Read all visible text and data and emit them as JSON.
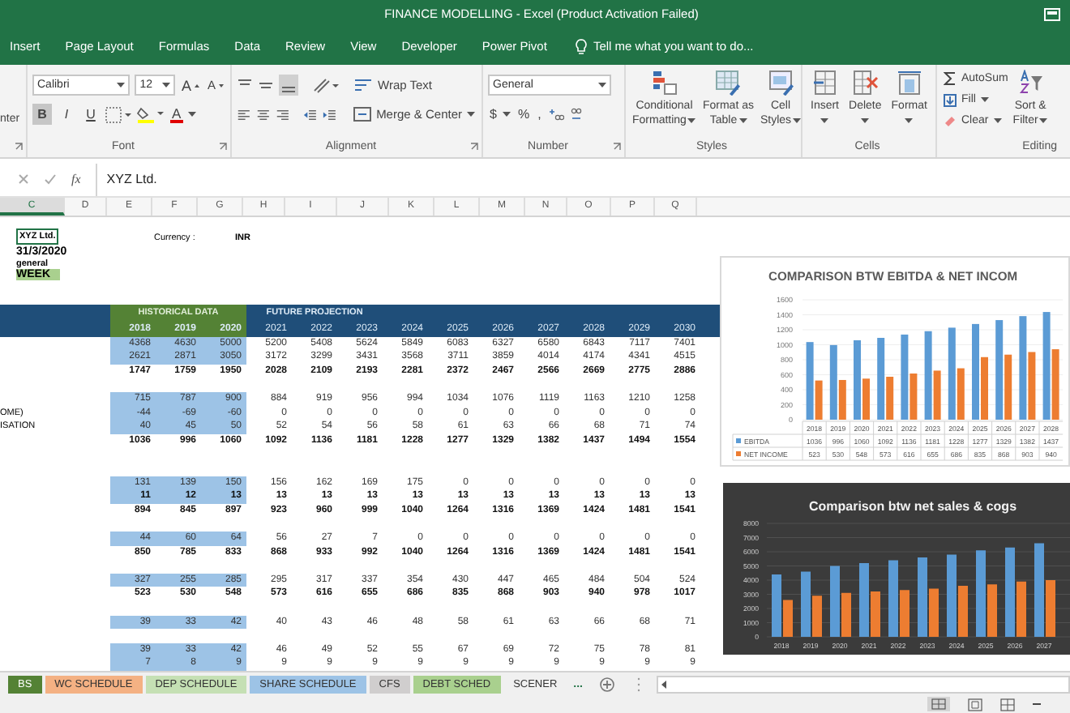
{
  "window": {
    "title": "FINANCE MODELLING - Excel (Product Activation Failed)"
  },
  "ribbon_tabs": [
    "Insert",
    "Page Layout",
    "Formulas",
    "Data",
    "Review",
    "View",
    "Developer",
    "Power Pivot"
  ],
  "tell_me": {
    "placeholder": "Tell me what you want to do..."
  },
  "ribbon": {
    "clipboard_partial": "nter",
    "font": {
      "name": "Calibri",
      "size": "12",
      "grow": "A",
      "shrink": "A",
      "font_color": "A",
      "label": "Font",
      "styles": [
        {
          "label": "B",
          "on": true
        },
        {
          "label": "I",
          "on": false
        },
        {
          "label": "U",
          "on": false
        }
      ]
    },
    "alignment": {
      "wrap": "Wrap Text",
      "merge": "Merge & Center",
      "label": "Alignment"
    },
    "number": {
      "format": "General",
      "currency": "$",
      "percent": "%",
      "comma": ",",
      "label": "Number"
    },
    "styles": {
      "label": "Styles",
      "buttons": [
        {
          "kind": "conditional",
          "lines": [
            "Conditional",
            "Formatting"
          ]
        },
        {
          "kind": "table",
          "lines": [
            "Format as",
            "Table"
          ]
        },
        {
          "kind": "cellstyles",
          "lines": [
            "Cell",
            "Styles"
          ]
        }
      ]
    },
    "cells": {
      "label": "Cells",
      "buttons": [
        {
          "kind": "insert",
          "label": "Insert"
        },
        {
          "kind": "delete",
          "label": "Delete"
        },
        {
          "kind": "format",
          "label": "Format"
        }
      ]
    },
    "editing": {
      "label": "Editing",
      "autosum": "AutoSum",
      "fill": "Fill",
      "clear": "Clear",
      "sort_lines": [
        "Sort &",
        "Filter"
      ]
    }
  },
  "formula_bar": {
    "function_label": "fx",
    "value": "XYZ Ltd."
  },
  "column_headers": [
    {
      "label": "C",
      "selected": true
    },
    {
      "label": "D",
      "selected": false
    },
    {
      "label": "E",
      "selected": false
    },
    {
      "label": "F",
      "selected": false
    },
    {
      "label": "G",
      "selected": false
    },
    {
      "label": "H",
      "selected": false
    },
    {
      "label": "I",
      "selected": false
    },
    {
      "label": "J",
      "selected": false
    },
    {
      "label": "K",
      "selected": false
    },
    {
      "label": "L",
      "selected": false
    },
    {
      "label": "M",
      "selected": false
    },
    {
      "label": "N",
      "selected": false
    },
    {
      "label": "O",
      "selected": false
    },
    {
      "label": "P",
      "selected": false
    },
    {
      "label": "Q",
      "selected": false
    }
  ],
  "sheet": {
    "company": "XYZ Ltd.",
    "date": "31/3/2020",
    "type": "general",
    "period": "WEEK",
    "currency_label": "Currency :",
    "currency": "INR"
  },
  "projection_table": {
    "historical_label": "HISTORICAL DATA",
    "projection_label": "FUTURE PROJECTION",
    "historical_years": [
      "2018",
      "2019",
      "2020"
    ],
    "projection_years": [
      "2021",
      "2022",
      "2023",
      "2024",
      "2025",
      "2026",
      "2027",
      "2028",
      "2029",
      "2030"
    ],
    "rows": [
      {
        "kind": "values",
        "shaded": true,
        "bold": false,
        "values": [
          "4368",
          "4630",
          "5000",
          "5200",
          "5408",
          "5624",
          "5849",
          "6083",
          "6327",
          "6580",
          "6843",
          "7117",
          "7401"
        ]
      },
      {
        "kind": "values",
        "shaded": true,
        "bold": false,
        "values": [
          "2621",
          "2871",
          "3050",
          "3172",
          "3299",
          "3431",
          "3568",
          "3711",
          "3859",
          "4014",
          "4174",
          "4341",
          "4515"
        ]
      },
      {
        "kind": "values",
        "shaded": false,
        "bold": true,
        "values": [
          "1747",
          "1759",
          "1950",
          "2028",
          "2109",
          "2193",
          "2281",
          "2372",
          "2467",
          "2566",
          "2669",
          "2775",
          "2886"
        ]
      },
      {
        "kind": "empty"
      },
      {
        "kind": "values",
        "shaded": true,
        "bold": false,
        "values": [
          "715",
          "787",
          "900",
          "884",
          "919",
          "956",
          "994",
          "1034",
          "1076",
          "1119",
          "1163",
          "1210",
          "1258"
        ]
      },
      {
        "kind": "values",
        "label": "OME)",
        "shaded": true,
        "bold": false,
        "values": [
          "-44",
          "-69",
          "-60",
          "0",
          "0",
          "0",
          "0",
          "0",
          "0",
          "0",
          "0",
          "0",
          "0"
        ]
      },
      {
        "kind": "values",
        "label": "ISATION",
        "shaded": true,
        "bold": false,
        "values": [
          "40",
          "45",
          "50",
          "52",
          "54",
          "56",
          "58",
          "61",
          "63",
          "66",
          "68",
          "71",
          "74"
        ]
      },
      {
        "kind": "values",
        "shaded": false,
        "bold": true,
        "values": [
          "1036",
          "996",
          "1060",
          "1092",
          "1136",
          "1181",
          "1228",
          "1277",
          "1329",
          "1382",
          "1437",
          "1494",
          "1554"
        ]
      },
      {
        "kind": "empty"
      },
      {
        "kind": "empty"
      },
      {
        "kind": "values",
        "shaded": true,
        "bold": false,
        "values": [
          "131",
          "139",
          "150",
          "156",
          "162",
          "169",
          "175",
          "0",
          "0",
          "0",
          "0",
          "0",
          "0"
        ]
      },
      {
        "kind": "values",
        "shaded": true,
        "bold": true,
        "values": [
          "11",
          "12",
          "13",
          "13",
          "13",
          "13",
          "13",
          "13",
          "13",
          "13",
          "13",
          "13",
          "13"
        ]
      },
      {
        "kind": "values",
        "shaded": false,
        "bold": true,
        "values": [
          "894",
          "845",
          "897",
          "923",
          "960",
          "999",
          "1040",
          "1264",
          "1316",
          "1369",
          "1424",
          "1481",
          "1541"
        ]
      },
      {
        "kind": "empty"
      },
      {
        "kind": "values",
        "shaded": true,
        "bold": false,
        "values": [
          "44",
          "60",
          "64",
          "56",
          "27",
          "7",
          "0",
          "0",
          "0",
          "0",
          "0",
          "0",
          "0"
        ]
      },
      {
        "kind": "values",
        "shaded": false,
        "bold": true,
        "values": [
          "850",
          "785",
          "833",
          "868",
          "933",
          "992",
          "1040",
          "1264",
          "1316",
          "1369",
          "1424",
          "1481",
          "1541"
        ]
      },
      {
        "kind": "empty"
      },
      {
        "kind": "values",
        "shaded": true,
        "bold": false,
        "values": [
          "327",
          "255",
          "285",
          "295",
          "317",
          "337",
          "354",
          "430",
          "447",
          "465",
          "484",
          "504",
          "524"
        ]
      },
      {
        "kind": "values",
        "shaded": false,
        "bold": true,
        "values": [
          "523",
          "530",
          "548",
          "573",
          "616",
          "655",
          "686",
          "835",
          "868",
          "903",
          "940",
          "978",
          "1017"
        ]
      },
      {
        "kind": "empty"
      },
      {
        "kind": "values",
        "shaded": true,
        "bold": false,
        "values": [
          "39",
          "33",
          "42",
          "40",
          "43",
          "46",
          "48",
          "58",
          "61",
          "63",
          "66",
          "68",
          "71"
        ]
      },
      {
        "kind": "empty"
      },
      {
        "kind": "values",
        "shaded": true,
        "bold": false,
        "values": [
          "39",
          "33",
          "42",
          "46",
          "49",
          "52",
          "55",
          "67",
          "69",
          "72",
          "75",
          "78",
          "81"
        ]
      },
      {
        "kind": "values",
        "shaded": true,
        "bold": false,
        "values": [
          "7",
          "8",
          "9",
          "9",
          "9",
          "9",
          "9",
          "9",
          "9",
          "9",
          "9",
          "9",
          "9"
        ]
      }
    ]
  },
  "charts": [
    {
      "chart_data": {
        "type": "bar",
        "title": "COMPARISON BTW EBITDA & NET INCOM",
        "categories": [
          "2018",
          "2019",
          "2020",
          "2021",
          "2022",
          "2023",
          "2024",
          "2025",
          "2026",
          "2027",
          "2028"
        ],
        "series": [
          {
            "name": "EBITDA",
            "color": "#5b9bd5",
            "values": [
              1036,
              996,
              1060,
              1092,
              1136,
              1181,
              1228,
              1277,
              1329,
              1382,
              1437
            ]
          },
          {
            "name": "NET INCOME",
            "color": "#ed7d31",
            "values": [
              523,
              530,
              548,
              573,
              616,
              655,
              686,
              835,
              868,
              903,
              940
            ]
          }
        ],
        "ylim": [
          0,
          1600
        ],
        "yticks": [
          {
            "value": 0,
            "label": "0"
          },
          {
            "value": 200,
            "label": "200"
          },
          {
            "value": 400,
            "label": "400"
          },
          {
            "value": 600,
            "label": "600"
          },
          {
            "value": 800,
            "label": "800"
          },
          {
            "value": 1000,
            "label": "1000"
          },
          {
            "value": 1200,
            "label": "1200"
          },
          {
            "value": 1400,
            "label": "1400"
          },
          {
            "value": 1600,
            "label": "1600"
          }
        ],
        "grid": true,
        "legend": true
      },
      "data_table": [
        {
          "values": [
            "1036",
            "996",
            "1060",
            "1092",
            "1136",
            "1181",
            "1228",
            "1277",
            "1329",
            "1382",
            "1437"
          ]
        },
        {
          "values": [
            "523",
            "530",
            "548",
            "573",
            "616",
            "655",
            "686",
            "835",
            "868",
            "903",
            "940"
          ]
        }
      ]
    },
    {
      "chart_data": {
        "type": "bar",
        "title": "Comparison btw net sales & cogs",
        "categories": [
          "2018",
          "2019",
          "2020",
          "2021",
          "2022",
          "2023",
          "2024",
          "2025",
          "2026",
          "2027"
        ],
        "series": [
          {
            "color": "#5b9bd5",
            "values": [
              4400,
              4600,
              5000,
              5200,
              5400,
              5600,
              5800,
              6100,
              6300,
              6600
            ]
          },
          {
            "color": "#ed7d31",
            "values": [
              2600,
              2900,
              3100,
              3200,
              3300,
              3400,
              3600,
              3700,
              3900,
              4000
            ]
          }
        ],
        "ylim": [
          0,
          8000
        ],
        "yticks": [
          {
            "value": 0,
            "label": "0"
          },
          {
            "value": 1000,
            "label": "1000"
          },
          {
            "value": 2000,
            "label": "2000"
          },
          {
            "value": 3000,
            "label": "3000"
          },
          {
            "value": 4000,
            "label": "4000"
          },
          {
            "value": 5000,
            "label": "5000"
          },
          {
            "value": 6000,
            "label": "6000"
          },
          {
            "value": 7000,
            "label": "7000"
          },
          {
            "value": 8000,
            "label": "8000"
          }
        ],
        "grid": true
      }
    }
  ],
  "sheet_tabs": [
    {
      "label": "BS",
      "color": "#548235",
      "selected": true
    },
    {
      "label": "WC SCHEDULE",
      "color": "#f4b183",
      "selected": false
    },
    {
      "label": "DEP SCHEDULE",
      "color": "#c5e0b4",
      "selected": false
    },
    {
      "label": "SHARE SCHEDULE",
      "color": "#9dc3e6",
      "selected": false
    },
    {
      "label": "CFS",
      "color": "#d0cece",
      "selected": false
    },
    {
      "label": "DEBT SCHED",
      "color": "#a9d08e",
      "selected": false
    },
    {
      "label": "SCENER",
      "selected": false
    }
  ],
  "more_tabs": "..."
}
